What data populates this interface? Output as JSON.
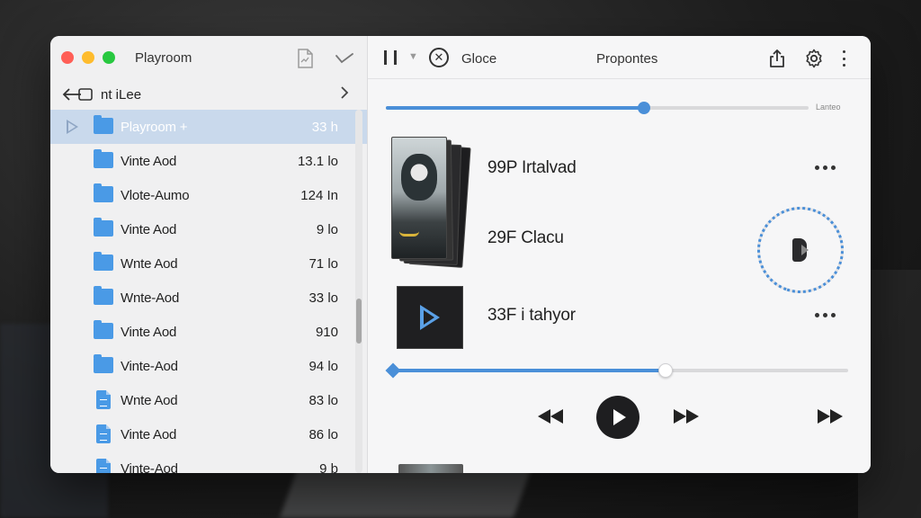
{
  "window": {
    "app_title": "Playroom"
  },
  "sidebar": {
    "path_label": "nt iLee",
    "items": [
      {
        "name": "Playroom +",
        "size": "33 h",
        "type": "folder",
        "selected": true
      },
      {
        "name": "Vinte Aod",
        "size": "13.1 lo",
        "type": "folder"
      },
      {
        "name": "Vlote-Aumo",
        "size": "124 In",
        "type": "folder"
      },
      {
        "name": "Vinte Aod",
        "size": "9 lo",
        "type": "folder"
      },
      {
        "name": "Wnte Aod",
        "size": "71 lo",
        "type": "folder"
      },
      {
        "name": "Wnte-Aod",
        "size": "33 lo",
        "type": "folder"
      },
      {
        "name": "Vinte Aod",
        "size": "910",
        "type": "folder"
      },
      {
        "name": "Vinte-Aod",
        "size": "94 lo",
        "type": "folder"
      },
      {
        "name": "Wnte Aod",
        "size": "83 lo",
        "type": "file"
      },
      {
        "name": "Vinte Aod",
        "size": "86 lo",
        "type": "file"
      },
      {
        "name": "Vinte-Aod",
        "size": "9 b",
        "type": "file"
      }
    ]
  },
  "toolbar": {
    "label_a": "Gloce",
    "title": "Propontes"
  },
  "top_slider": {
    "caption": "Lanteo",
    "progress": 0.61
  },
  "tracks": [
    {
      "title": "99P Irtalvad"
    },
    {
      "title": "29F Clacu"
    },
    {
      "title": "33F i tahyor"
    }
  ],
  "ring_progress": 0.35,
  "bottom_slider": {
    "progress": 0.6
  },
  "colors": {
    "accent": "#4a8fd8",
    "folder": "#4a9ae6",
    "selected_row": "#c9d9ec"
  }
}
